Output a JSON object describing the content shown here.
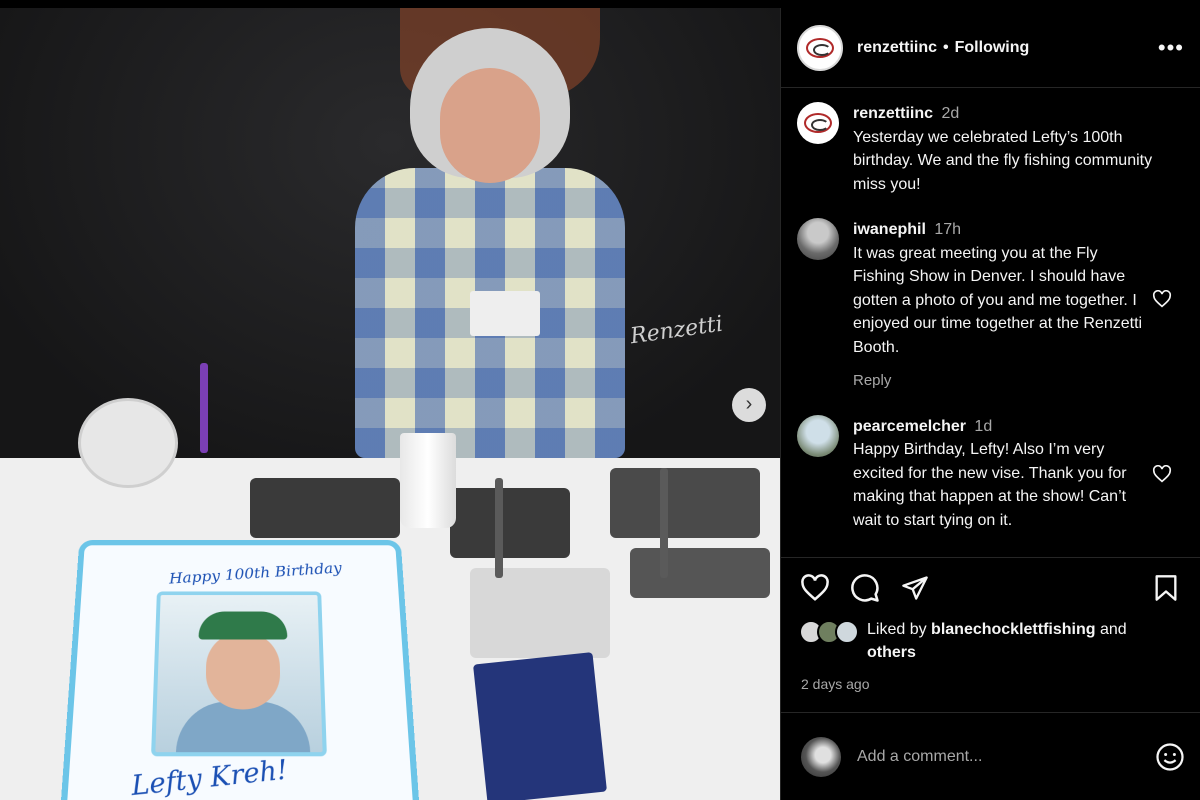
{
  "post": {
    "author": "renzettiinc",
    "separator": "•",
    "follow_state": "Following",
    "more": "•••"
  },
  "photo": {
    "cake_text": "Happy 100th Birthday",
    "cake_signature": "Lefty Kreh!",
    "backdrop_signature": "Renzetti",
    "next_arrow": "›"
  },
  "caption": {
    "user": "renzettiinc",
    "time": "2d",
    "text": "Yesterday we celebrated Lefty’s 100th birthday. We and the fly fishing community miss you!"
  },
  "comments": [
    {
      "user": "iwanephil",
      "time": "17h",
      "text": "It was great meeting you at the Fly Fishing Show in Denver. I should have gotten a photo of you and me together. I enjoyed our time together at the Renzetti Booth.",
      "reply": "Reply"
    },
    {
      "user": "pearcemelcher",
      "time": "1d",
      "text": "Happy Birthday, Lefty! Also I’m very excited for the new vise. Thank you for making that happen at the show! Can’t wait to start tying on it."
    }
  ],
  "likes": {
    "prefix": "Liked by",
    "user": "blanechocklettfishing",
    "middle": "and",
    "suffix": "others"
  },
  "date": "2 days ago",
  "comment_box": {
    "placeholder": "Add a comment..."
  },
  "colors": {
    "background": "#000000",
    "text": "#f5f5f5",
    "muted": "#a8a8a8",
    "divider": "#262626"
  },
  "icons": [
    "more-icon",
    "heart-icon",
    "comment-icon",
    "share-icon",
    "bookmark-icon",
    "emoji-icon",
    "next-arrow-icon"
  ]
}
